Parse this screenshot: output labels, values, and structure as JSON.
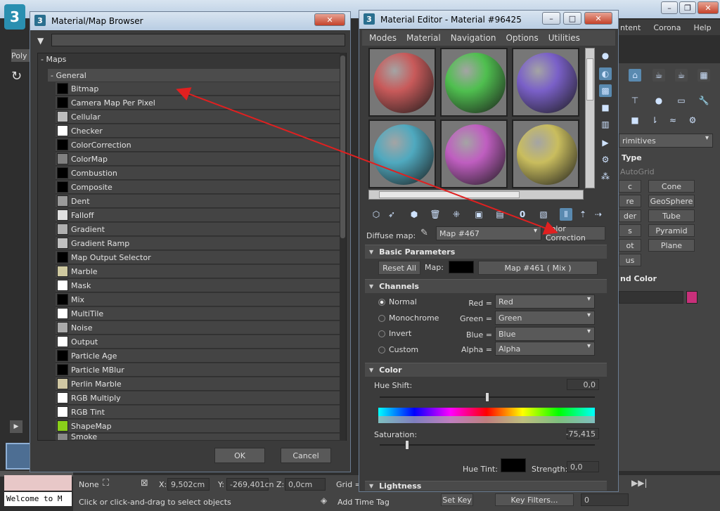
{
  "browser": {
    "title": "Material/Map Browser",
    "root_group": "- Maps",
    "sub_group": "- General",
    "items": [
      {
        "label": "Bitmap",
        "swatch": "#000000"
      },
      {
        "label": "Camera Map Per Pixel",
        "swatch": "#000000"
      },
      {
        "label": "Cellular",
        "swatch": "#bdbdbd"
      },
      {
        "label": "Checker",
        "swatch": "#ffffff"
      },
      {
        "label": "ColorCorrection",
        "swatch": "#000000"
      },
      {
        "label": "ColorMap",
        "swatch": "#808080"
      },
      {
        "label": "Combustion",
        "swatch": "#000000"
      },
      {
        "label": "Composite",
        "swatch": "#000000"
      },
      {
        "label": "Dent",
        "swatch": "#9a9a9a"
      },
      {
        "label": "Falloff",
        "swatch": "#e0e0e0"
      },
      {
        "label": "Gradient",
        "swatch": "#b0b0b0"
      },
      {
        "label": "Gradient Ramp",
        "swatch": "#c0c0c0"
      },
      {
        "label": "Map Output Selector",
        "swatch": "#000000"
      },
      {
        "label": "Marble",
        "swatch": "#cfc9a0"
      },
      {
        "label": "Mask",
        "swatch": "#ffffff"
      },
      {
        "label": "Mix",
        "swatch": "#000000"
      },
      {
        "label": "MultiTile",
        "swatch": "#ffffff"
      },
      {
        "label": "Noise",
        "swatch": "#aaaaaa"
      },
      {
        "label": "Output",
        "swatch": "#ffffff"
      },
      {
        "label": "Particle Age",
        "swatch": "#000000"
      },
      {
        "label": "Particle MBlur",
        "swatch": "#000000"
      },
      {
        "label": "Perlin Marble",
        "swatch": "#d0c7a3"
      },
      {
        "label": "RGB Multiply",
        "swatch": "#ffffff"
      },
      {
        "label": "RGB Tint",
        "swatch": "#ffffff"
      },
      {
        "label": "ShapeMap",
        "swatch": "#8ad01a"
      },
      {
        "label": "Smoke",
        "swatch": "#888888"
      }
    ],
    "ok": "OK",
    "cancel": "Cancel"
  },
  "editor": {
    "title": "Material Editor - Material #96425",
    "menu": [
      "Modes",
      "Material",
      "Navigation",
      "Options",
      "Utilities"
    ],
    "spheres": [
      "#c85a5a",
      "#4fbf4f",
      "#7a60c8",
      "#4fa9bf",
      "#bf5ec0",
      "#c9bd5e"
    ],
    "diffuse_label": "Diffuse map:",
    "diffuse_value": "Map #467",
    "map_type": "Color Correction",
    "basic": {
      "head": "Basic Parameters",
      "reset": "Reset All",
      "map_label": "Map:",
      "map_value": "Map #461  ( Mix )"
    },
    "channels": {
      "head": "Channels",
      "modes": [
        "Normal",
        "Monochrome",
        "Invert",
        "Custom"
      ],
      "labels": [
        "Red =",
        "Green =",
        "Blue =",
        "Alpha ="
      ],
      "values": [
        "Red",
        "Green",
        "Blue",
        "Alpha"
      ]
    },
    "color": {
      "head": "Color",
      "hue_label": "Hue Shift:",
      "hue_value": "0,0",
      "hue_level": 0.5,
      "sat_label": "Saturation:",
      "sat_value": "-75,415",
      "sat_level": 0.12,
      "tint_label": "Hue Tint:",
      "tint_color": "#000000",
      "strength_label": "Strength:",
      "strength_value": "0,0"
    },
    "lightness_head": "Lightness"
  },
  "main": {
    "menu_items": [
      "ntent",
      "Corona",
      "Help"
    ],
    "poly": "Poly",
    "panel_primitives": "rimitives",
    "object_type": "Type",
    "autogrid": "AutoGrid",
    "prim_buttons": [
      "Cone",
      "GeoSphere",
      "Tube",
      "Pyramid",
      "Plane"
    ],
    "left_frag": [
      "c",
      "re",
      "der",
      "s",
      "ot",
      "us"
    ],
    "name_color": "nd Color",
    "name_color_swatch": "#c8307a",
    "status": {
      "sel": "None",
      "x_label": "X:",
      "x": "9,502cm",
      "y_label": "Y:",
      "y": "-269,401cn",
      "z_label": "Z:",
      "z": "0,0cm",
      "grid": "Grid =",
      "prompt": "Click or click-and-drag to select objects",
      "add_time_tag": "Add Time Tag",
      "set_key": "Set Key",
      "key_filters": "Key Filters...",
      "frame": "0"
    },
    "welcome": "Welcome to M"
  }
}
